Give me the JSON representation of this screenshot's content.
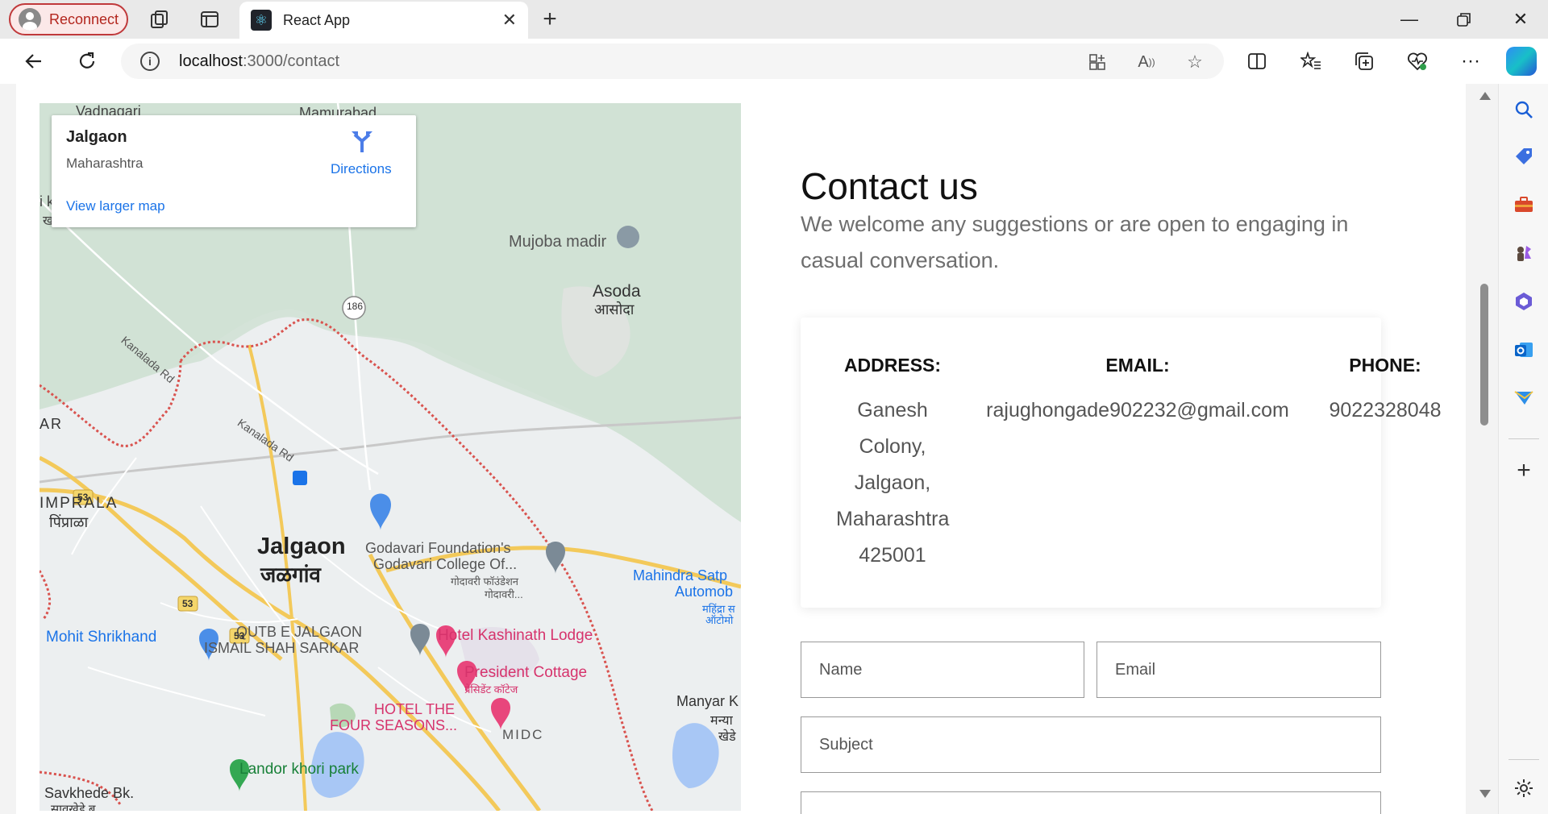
{
  "browser": {
    "reconnect_label": "Reconnect",
    "tab_title": "React App",
    "url_host": "localhost",
    "url_path": ":3000/contact"
  },
  "map": {
    "card_title": "Jalgaon",
    "card_subtitle": "Maharashtra",
    "directions_label": "Directions",
    "larger_map_link": "View larger map",
    "labels": {
      "vadnagari": "Vadnagari",
      "mamurabad": "Mamurabad",
      "mujoba": "Mujoba madir",
      "asoda": "Asoda",
      "asoda_mr": "आसोदा",
      "road_186": "186",
      "kanalada1": "Kanalada Rd",
      "kanalada2": "Kanalada Rd",
      "ar": "AR",
      "pimprala": "IMPRALA",
      "pimprala_mr": "पिंप्राळा",
      "jalgaon": "Jalgaon",
      "jalgaon_mr": "जळगांव",
      "godavari_found": "Godavari Foundation's",
      "godavari_college": "Godavari College Of...",
      "godavari_mr1": "गोदावरी फॉउंडेशन",
      "godavari_mr2": "गोदावरी...",
      "mahindra1": "Mahindra Satp",
      "mahindra2": "Automob",
      "mahindra_mr1": "महिंद्रा स",
      "mahindra_mr2": "ऑटोमो",
      "mohit": "Mohit Shrikhand",
      "qutb1": "QUTB E JALGAON",
      "qutb2": "ISMAIL SHAH SARKAR",
      "kashinath": "Hotel Kashinath Lodge",
      "president": "President Cottage",
      "president_mr": "प्रेसिडेंट कॉटेज",
      "four_seasons1": "HOTEL THE",
      "four_seasons2": "FOUR SEASONS...",
      "midc": "MIDC",
      "manyar": "Manyar K",
      "manyar_mr1": "मन्या",
      "manyar_mr2": "खेडे",
      "landor": "Landor khori park",
      "savkhede": "Savkhede Bk.",
      "savkhede_mr": "सावखेडे बु.",
      "nh53a": "53",
      "nh53b": "53",
      "nh53c": "53",
      "left_k": "i k",
      "left_k2": "ख"
    }
  },
  "contact": {
    "title": "Contact us",
    "description": "We welcome any suggestions or are open to engaging in casual conversation.",
    "address_heading": "ADDRESS:",
    "address_lines": [
      "Ganesh",
      "Colony,",
      "Jalgaon,",
      "Maharashtra",
      "425001"
    ],
    "email_heading": "EMAIL:",
    "email_value": "rajughongade902232@gmail.com",
    "phone_heading": "PHONE:",
    "phone_value": "9022328048",
    "form": {
      "name_placeholder": "Name",
      "email_placeholder": "Email",
      "subject_placeholder": "Subject"
    }
  }
}
